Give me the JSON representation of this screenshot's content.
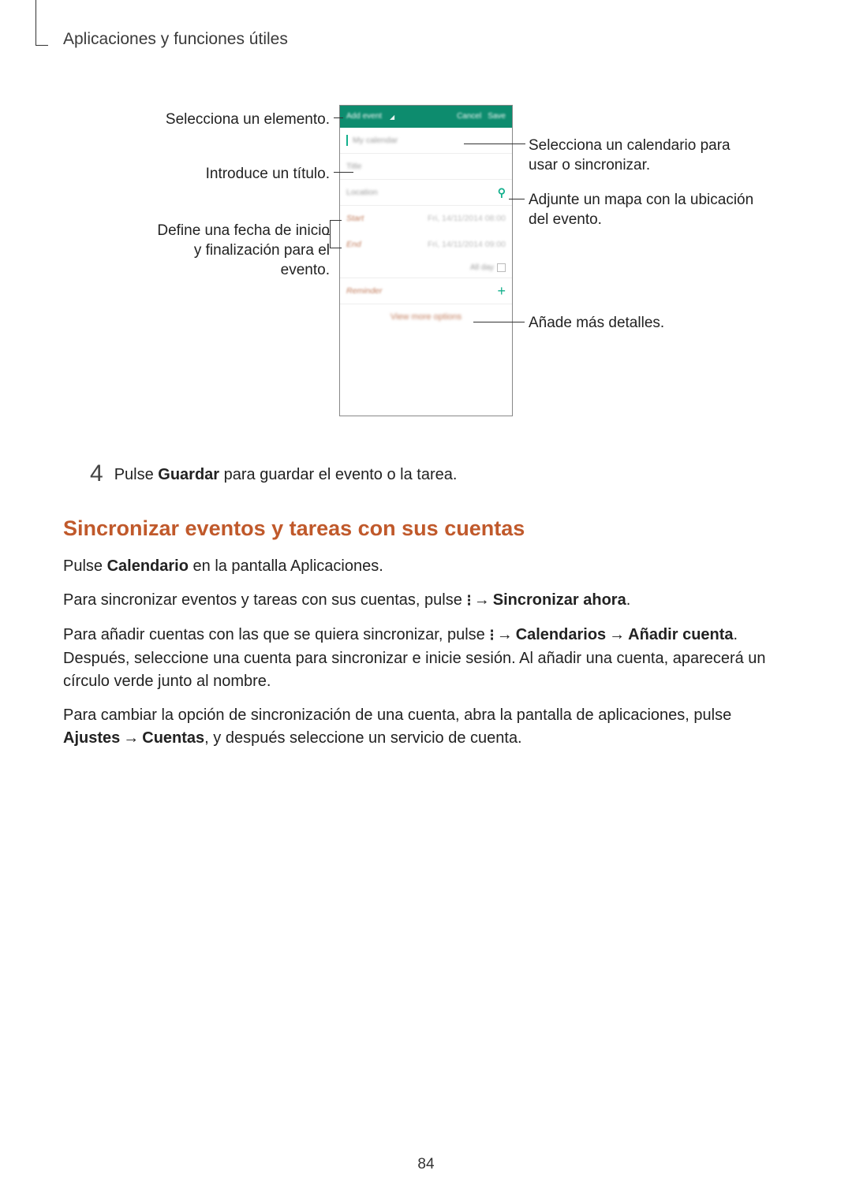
{
  "breadcrumb": "Aplicaciones y funciones útiles",
  "figure": {
    "left_callout_1": "Selecciona un elemento.",
    "left_callout_2": "Introduce un título.",
    "left_callout_3": "Define una fecha de inicio y finalización para el evento.",
    "right_callout_1": "Selecciona un calendario para usar o sincronizar.",
    "right_callout_2": "Adjunte un mapa con la ubicación del evento.",
    "right_callout_3": "Añade más detalles."
  },
  "phone": {
    "header_add": "Add event",
    "header_cancel": "Cancel",
    "header_save": "Save",
    "calendar": "My calendar",
    "title": "Title",
    "location": "Location",
    "start_label": "Start",
    "start_value": "Fri, 14/11/2014  08:00",
    "end_label": "End",
    "end_value": "Fri, 14/11/2014  09:00",
    "allday": "All day",
    "reminder": "Reminder",
    "viewmore": "View more options"
  },
  "step4": {
    "num": "4",
    "text_a": "Pulse ",
    "text_bold": "Guardar",
    "text_b": " para guardar el evento o la tarea."
  },
  "heading": "Sincronizar eventos y tareas con sus cuentas",
  "paras": {
    "p1_a": "Pulse ",
    "p1_bold": "Calendario",
    "p1_b": " en la pantalla Aplicaciones.",
    "p2_a": "Para sincronizar eventos y tareas con sus cuentas, pulse ",
    "p2_bold": "Sincronizar ahora",
    "p2_b": ".",
    "p3_a": "Para añadir cuentas con las que se quiera sincronizar, pulse ",
    "p3_bold1": "Calendarios",
    "p3_bold2": "Añadir cuenta",
    "p3_b": ". Después, seleccione una cuenta para sincronizar e inicie sesión. Al añadir una cuenta, aparecerá un círculo verde junto al nombre.",
    "p4_a": "Para cambiar la opción de sincronización de una cuenta, abra la pantalla de aplicaciones, pulse ",
    "p4_bold1": "Ajustes",
    "p4_bold2": "Cuentas",
    "p4_b": ", y después seleccione un servicio de cuenta."
  },
  "arrow": "→",
  "more_dots": "⁝",
  "page_number": "84"
}
